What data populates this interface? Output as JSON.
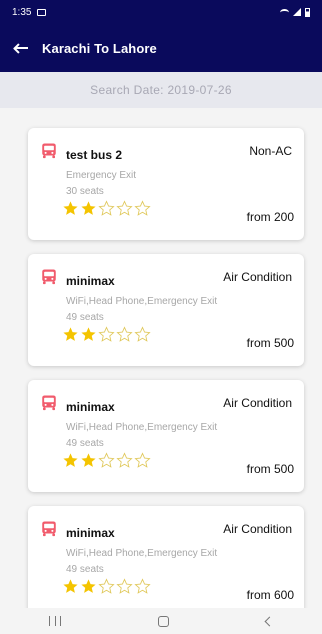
{
  "status_bar": {
    "time": "1:35",
    "gallery_icon": "image-icon",
    "right_icons": [
      "wifi-icon",
      "signal-icon",
      "battery-icon"
    ]
  },
  "app_bar": {
    "title": "Karachi To Lahore",
    "back_icon": "back-arrow-icon"
  },
  "search": {
    "date_text": "Search Date: 2019-07-26"
  },
  "colors": {
    "primary": "#0a0a5c",
    "bus_icon": "#f15b6c",
    "star_filled": "#f4c400",
    "star_empty": "#e0c85a"
  },
  "buses": [
    {
      "name": "test bus 2",
      "ac_type": "Non-AC",
      "features": "Emergency Exit",
      "seats": "30 seats",
      "rating": 2,
      "max_rating": 5,
      "price": "from 200"
    },
    {
      "name": "minimax",
      "ac_type": "Air Condition",
      "features": "WiFi,Head Phone,Emergency Exit",
      "seats": "49 seats",
      "rating": 2,
      "max_rating": 5,
      "price": "from 500"
    },
    {
      "name": "minimax",
      "ac_type": "Air Condition",
      "features": "WiFi,Head Phone,Emergency Exit",
      "seats": "49 seats",
      "rating": 2,
      "max_rating": 5,
      "price": "from 500"
    },
    {
      "name": "minimax",
      "ac_type": "Air Condition",
      "features": "WiFi,Head Phone,Emergency Exit",
      "seats": "49 seats",
      "rating": 2,
      "max_rating": 5,
      "price": "from 600"
    }
  ],
  "nav_bar": {
    "icons": [
      "recents-icon",
      "home-icon",
      "back-icon"
    ]
  }
}
